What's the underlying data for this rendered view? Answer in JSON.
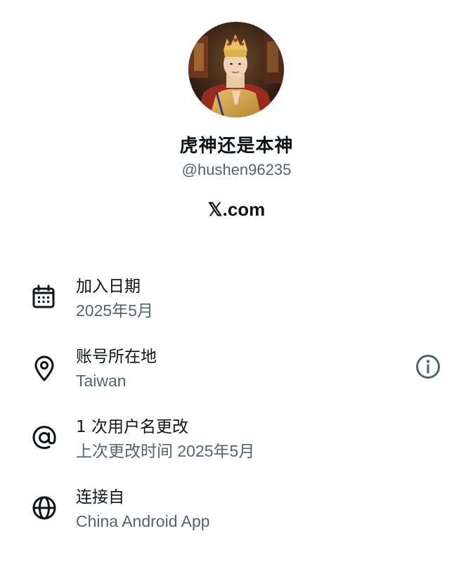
{
  "profile": {
    "display_name": "虎神还是本神",
    "handle": "@hushen96235",
    "source": "𝕏.com"
  },
  "info": {
    "joined": {
      "title": "加入日期",
      "value": "2025年5月",
      "icon": "calendar-icon"
    },
    "location": {
      "title": "账号所在地",
      "value": "Taiwan",
      "icon": "location-pin-icon",
      "action_icon": "info-icon"
    },
    "username_changes": {
      "title": "1 次用户名更改",
      "value": "上次更改时间 2025年5月",
      "icon": "at-sign-icon"
    },
    "connected_via": {
      "title": "连接自",
      "value": "China Android App",
      "icon": "globe-icon"
    }
  },
  "colors": {
    "primary_text": "#0f1419",
    "secondary_text": "#536471",
    "background": "#ffffff"
  }
}
